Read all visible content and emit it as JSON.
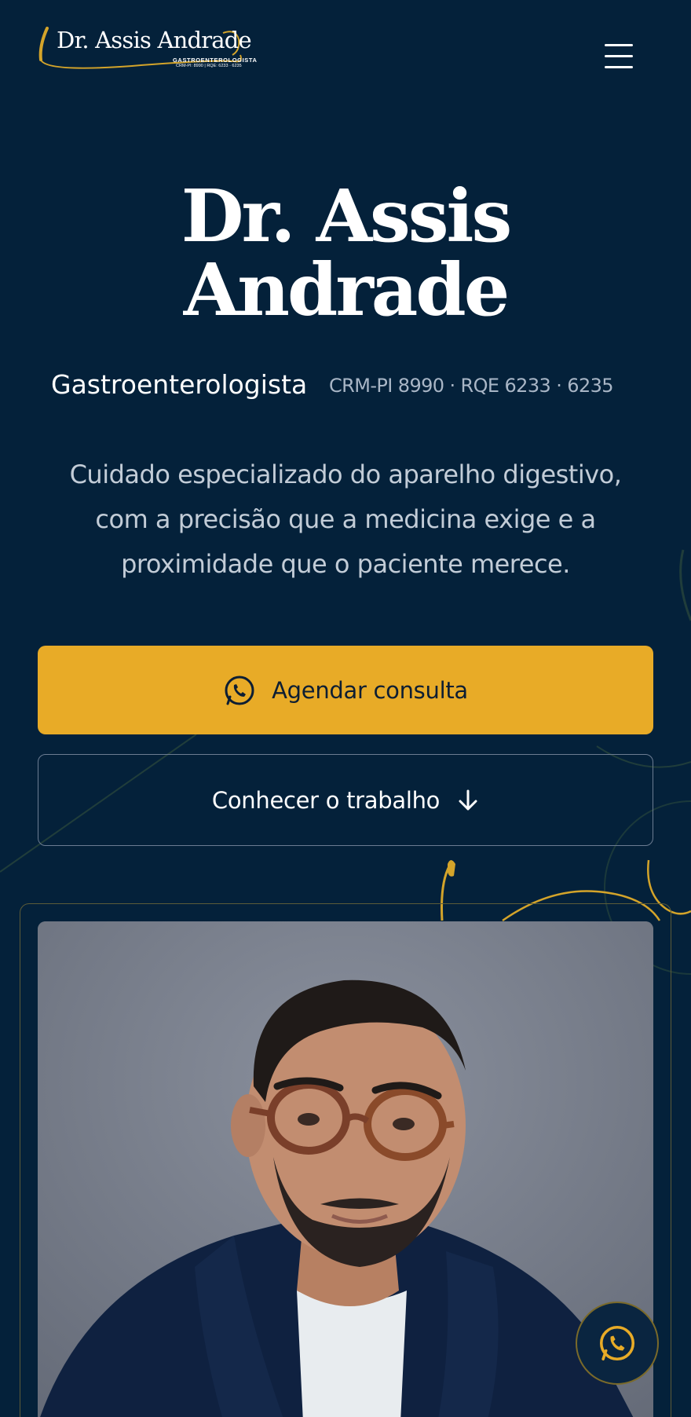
{
  "colors": {
    "background": "#04213a",
    "accent": "#e8ab27",
    "muted_text": "#a9b6c6",
    "white": "#ffffff"
  },
  "header": {
    "logo": {
      "name": "Dr. Assis Andrade",
      "specialty": "GASTROENTEROLOGISTA",
      "registration": "CRM-PI: 8990 | RQE: 6233 · 6235"
    },
    "menu_icon": "hamburger-menu-icon"
  },
  "hero": {
    "title_line1": "Dr. Assis",
    "title_line2": "Andrade",
    "specialty": "Gastroenterologista",
    "registry": "CRM-PI 8990 · RQE 6233 · 6235",
    "tagline_line1": "Cuidado especializado do aparelho digestivo,",
    "tagline_line2": "com a precisão que a medicina exige e a",
    "tagline_line3": "proximidade que o paciente merece."
  },
  "actions": {
    "primary_label": "Agendar consulta",
    "primary_icon": "whatsapp-icon",
    "secondary_label": "Conhecer o trabalho",
    "secondary_icon": "arrow-down-icon"
  },
  "photo": {
    "subject": "portrait"
  },
  "floating": {
    "icon": "whatsapp-icon"
  }
}
